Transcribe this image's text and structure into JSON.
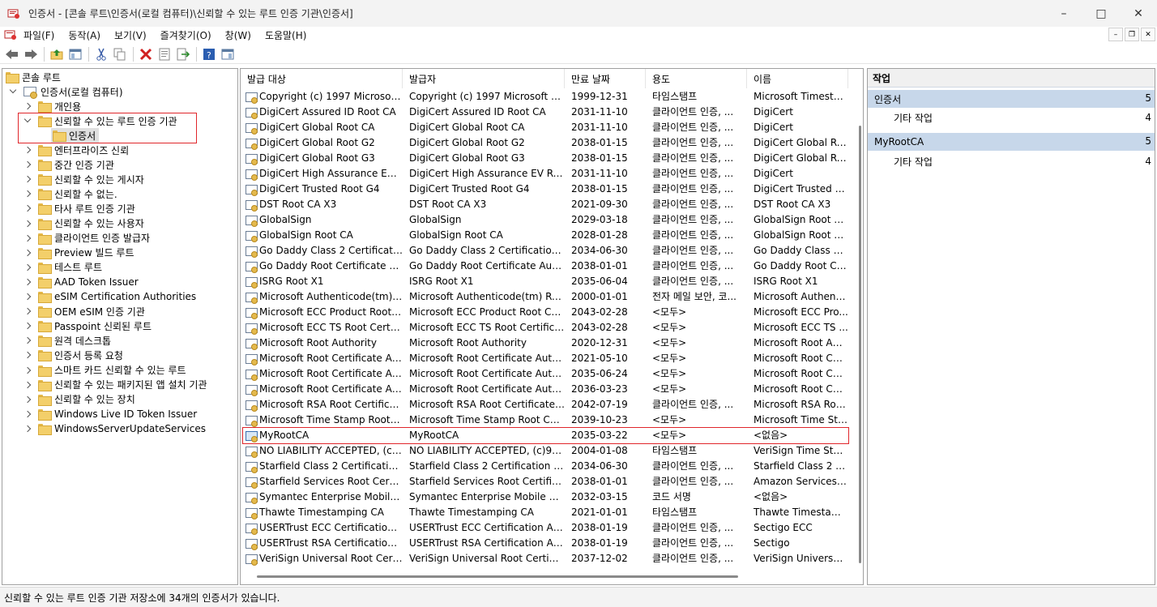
{
  "window": {
    "title": "인증서 - [콘솔 루트\\인증서(로컬 컴퓨터)\\신뢰할 수 있는 루트 인증 기관\\인증서]",
    "minimize_icon": "minimize-icon",
    "maximize_icon": "maximize-icon",
    "close_icon": "close-icon"
  },
  "menu": {
    "items": [
      "파일(F)",
      "동작(A)",
      "보기(V)",
      "즐겨찾기(O)",
      "창(W)",
      "도움말(H)"
    ],
    "mdi": [
      "–",
      "❐",
      "✕"
    ]
  },
  "toolbar": {
    "icons": [
      "back-icon",
      "forward-icon",
      "up-folder-icon",
      "show-hide-tree-icon",
      "cut-icon",
      "copy-icon",
      "delete-icon",
      "properties-icon",
      "export-icon",
      "help-icon",
      "show-hide-action-icon"
    ]
  },
  "tree": {
    "root": "콘솔 루트",
    "computer": "인증서(로컬 컴퓨터)",
    "personal": "개인용",
    "trusted_root": "신뢰할 수 있는 루트 인증 기관",
    "certificates": "인증서",
    "others": [
      "엔터프라이즈 신뢰",
      "중간 인증 기관",
      "신뢰할 수 있는 게시자",
      "신뢰할 수 없는.",
      "타사 루트 인증 기관",
      "신뢰할 수 있는 사용자",
      "클라이언트 인증 발급자",
      "Preview 빌드 루트",
      "테스트 루트",
      "AAD Token Issuer",
      "eSIM Certification Authorities",
      "OEM eSIM 인증 기관",
      "Passpoint 신뢰된 루트",
      "원격 데스크톱",
      "인증서 등록 요청",
      "스마트 카드 신뢰할 수 있는 루트",
      "신뢰할 수 있는 패키지된 앱 설치 기관",
      "신뢰할 수 있는 장치",
      "Windows Live ID Token Issuer",
      "WindowsServerUpdateServices"
    ]
  },
  "list": {
    "columns": [
      "발급 대상",
      "발급자",
      "만료 날짜",
      "용도",
      "이름"
    ],
    "sort_indicator": "^",
    "rows": [
      [
        "Copyright (c) 1997 Microsoft ...",
        "Copyright (c) 1997 Microsoft Co...",
        "1999-12-31",
        "타임스탬프",
        "Microsoft Timesta..."
      ],
      [
        "DigiCert Assured ID Root CA",
        "DigiCert Assured ID Root CA",
        "2031-11-10",
        "클라이언트 인증, ...",
        "DigiCert"
      ],
      [
        "DigiCert Global Root CA",
        "DigiCert Global Root CA",
        "2031-11-10",
        "클라이언트 인증, ...",
        "DigiCert"
      ],
      [
        "DigiCert Global Root G2",
        "DigiCert Global Root G2",
        "2038-01-15",
        "클라이언트 인증, ...",
        "DigiCert Global Ro..."
      ],
      [
        "DigiCert Global Root G3",
        "DigiCert Global Root G3",
        "2038-01-15",
        "클라이언트 인증, ...",
        "DigiCert Global Ro..."
      ],
      [
        "DigiCert High Assurance EV R...",
        "DigiCert High Assurance EV Root...",
        "2031-11-10",
        "클라이언트 인증, ...",
        "DigiCert"
      ],
      [
        "DigiCert Trusted Root G4",
        "DigiCert Trusted Root G4",
        "2038-01-15",
        "클라이언트 인증, ...",
        "DigiCert Trusted R..."
      ],
      [
        "DST Root CA X3",
        "DST Root CA X3",
        "2021-09-30",
        "클라이언트 인증, ...",
        "DST Root CA X3"
      ],
      [
        "GlobalSign",
        "GlobalSign",
        "2029-03-18",
        "클라이언트 인증, ...",
        "GlobalSign Root C..."
      ],
      [
        "GlobalSign Root CA",
        "GlobalSign Root CA",
        "2028-01-28",
        "클라이언트 인증, ...",
        "GlobalSign Root C..."
      ],
      [
        "Go Daddy Class 2 Certification...",
        "Go Daddy Class 2 Certification A...",
        "2034-06-30",
        "클라이언트 인증, ...",
        "Go Daddy Class 2 ..."
      ],
      [
        "Go Daddy Root Certificate Aut...",
        "Go Daddy Root Certificate Autho...",
        "2038-01-01",
        "클라이언트 인증, ...",
        "Go Daddy Root Ce..."
      ],
      [
        "ISRG Root X1",
        "ISRG Root X1",
        "2035-06-04",
        "클라이언트 인증, ...",
        "ISRG Root X1"
      ],
      [
        "Microsoft Authenticode(tm) R...",
        "Microsoft Authenticode(tm) Root...",
        "2000-01-01",
        "전자 메일 보안, 코...",
        "Microsoft Authenti..."
      ],
      [
        "Microsoft ECC Product Root C...",
        "Microsoft ECC Product Root Cert...",
        "2043-02-28",
        "<모두>",
        "Microsoft ECC Pro..."
      ],
      [
        "Microsoft ECC TS Root Certific...",
        "Microsoft ECC TS Root Certificat...",
        "2043-02-28",
        "<모두>",
        "Microsoft ECC TS ..."
      ],
      [
        "Microsoft Root Authority",
        "Microsoft Root Authority",
        "2020-12-31",
        "<모두>",
        "Microsoft Root Aut..."
      ],
      [
        "Microsoft Root Certificate Aut...",
        "Microsoft Root Certificate Author...",
        "2021-05-10",
        "<모두>",
        "Microsoft Root Cer..."
      ],
      [
        "Microsoft Root Certificate Aut...",
        "Microsoft Root Certificate Author...",
        "2035-06-24",
        "<모두>",
        "Microsoft Root Cer..."
      ],
      [
        "Microsoft Root Certificate Aut...",
        "Microsoft Root Certificate Author...",
        "2036-03-23",
        "<모두>",
        "Microsoft Root Cer..."
      ],
      [
        "Microsoft RSA Root Certificate...",
        "Microsoft RSA Root Certificate A...",
        "2042-07-19",
        "클라이언트 인증, ...",
        "Microsoft RSA Roo..."
      ],
      [
        "Microsoft Time Stamp Root Ce...",
        "Microsoft Time Stamp Root Certi...",
        "2039-10-23",
        "<모두>",
        "Microsoft Time Sta..."
      ],
      [
        "MyRootCA",
        "MyRootCA",
        "2035-03-22",
        "<모두>",
        "<없음>"
      ],
      [
        "NO LIABILITY ACCEPTED, (c)9...",
        "NO LIABILITY ACCEPTED, (c)97 ...",
        "2004-01-08",
        "타임스탬프",
        "VeriSign Time Sta..."
      ],
      [
        "Starfield Class 2 Certification A...",
        "Starfield Class 2 Certification Aut...",
        "2034-06-30",
        "클라이언트 인증, ...",
        "Starfield Class 2 Ce..."
      ],
      [
        "Starfield Services Root Certific...",
        "Starfield Services Root Certificate...",
        "2038-01-01",
        "클라이언트 인증, ...",
        "Amazon Services R..."
      ],
      [
        "Symantec Enterprise Mobile R...",
        "Symantec Enterprise Mobile Root...",
        "2032-03-15",
        "코드 서명",
        "<없음>"
      ],
      [
        "Thawte Timestamping CA",
        "Thawte Timestamping CA",
        "2021-01-01",
        "타임스탬프",
        "Thawte Timestampi..."
      ],
      [
        "USERTrust ECC Certification A...",
        "USERTrust ECC Certification Auth...",
        "2038-01-19",
        "클라이언트 인증, ...",
        "Sectigo ECC"
      ],
      [
        "USERTrust RSA Certification A...",
        "USERTrust RSA Certification Auth...",
        "2038-01-19",
        "클라이언트 인증, ...",
        "Sectigo"
      ],
      [
        "VeriSign Universal Root Certifi...",
        "VeriSign Universal Root Certificat...",
        "2037-12-02",
        "클라이언트 인증, ...",
        "VeriSign Universal ..."
      ]
    ],
    "highlighted_row": "MyRootCA"
  },
  "actions": {
    "title": "작업",
    "sections": [
      {
        "label": "인증서",
        "arrow": "5",
        "item": "기타 작업",
        "item_arrow": "4"
      },
      {
        "label": "MyRootCA",
        "arrow": "5",
        "item": "기타 작업",
        "item_arrow": "4"
      }
    ]
  },
  "status": {
    "text": "신뢰할 수 있는 루트 인증 기관 저장소에 34개의 인증서가 있습니다."
  },
  "colors": {
    "highlight_box": "#e0262b",
    "action_section_bg": "#c7d7ea",
    "folder": "#f3cf6a"
  }
}
